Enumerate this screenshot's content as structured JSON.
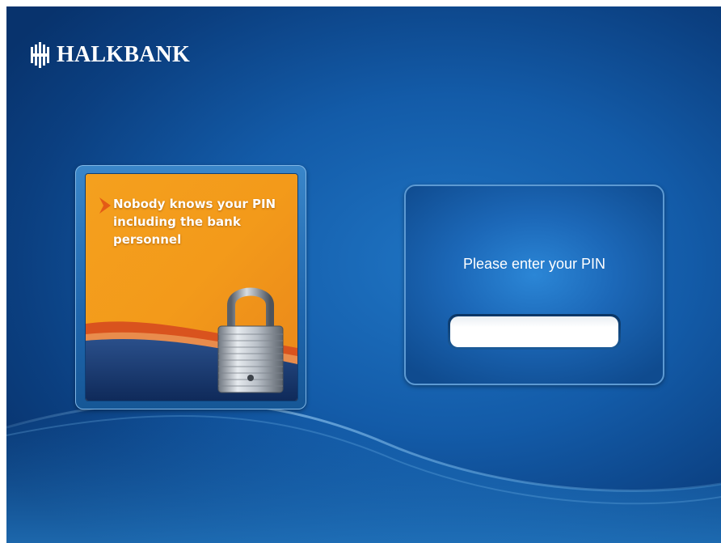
{
  "brand": {
    "name": "HALKBANK"
  },
  "promo": {
    "message": "Nobody knows your PIN including the bank personnel"
  },
  "pin_panel": {
    "prompt": "Please enter your PIN",
    "input_value": ""
  },
  "icons": {
    "logo": "halkbank-logo-icon",
    "chevron": "chevron-right-icon",
    "padlock": "padlock-icon"
  },
  "colors": {
    "background": "#135ba8",
    "promo_orange": "#f59a1b",
    "panel_blue": "#1c68b8",
    "text": "#ffffff"
  }
}
